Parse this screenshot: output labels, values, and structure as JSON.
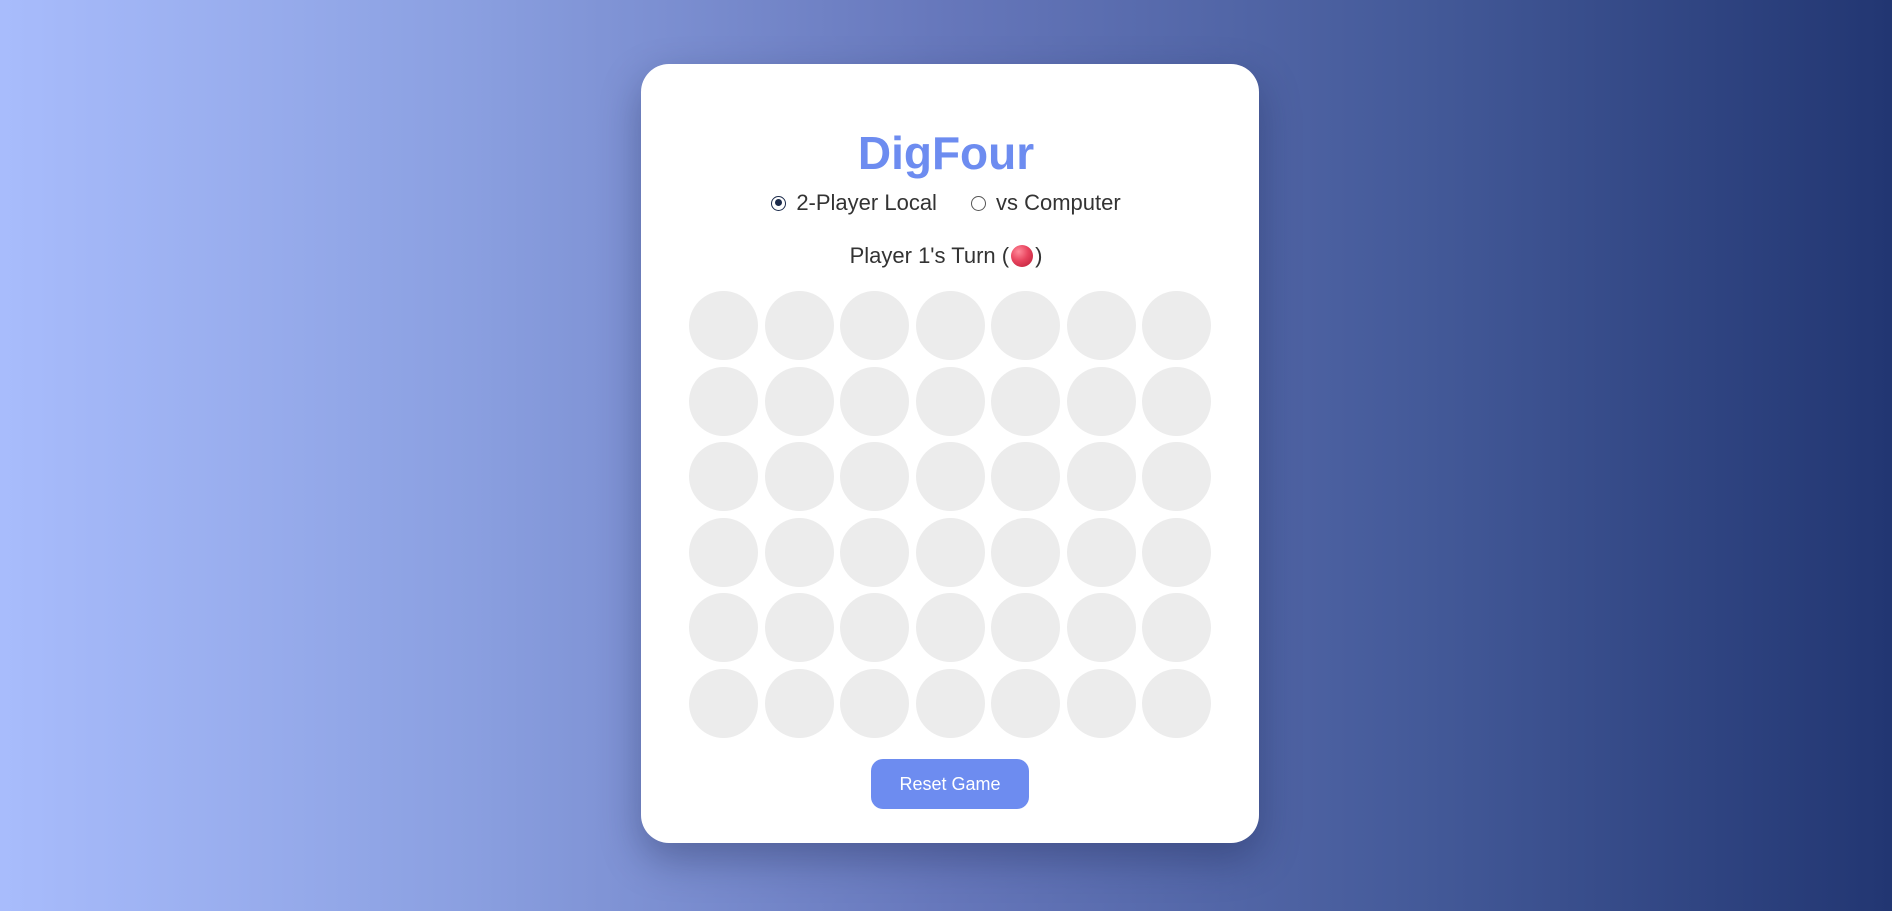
{
  "game": {
    "title": "DigFour",
    "modes": [
      {
        "label": "2-Player Local",
        "selected": true
      },
      {
        "label": "vs Computer",
        "selected": false
      }
    ],
    "status": {
      "prefix": "Player 1's Turn (",
      "suffix": ")",
      "current_player_color": "#e8445e"
    },
    "board": {
      "rows": 6,
      "columns": 7,
      "cells": [
        [
          "empty",
          "empty",
          "empty",
          "empty",
          "empty",
          "empty",
          "empty"
        ],
        [
          "empty",
          "empty",
          "empty",
          "empty",
          "empty",
          "empty",
          "empty"
        ],
        [
          "empty",
          "empty",
          "empty",
          "empty",
          "empty",
          "empty",
          "empty"
        ],
        [
          "empty",
          "empty",
          "empty",
          "empty",
          "empty",
          "empty",
          "empty"
        ],
        [
          "empty",
          "empty",
          "empty",
          "empty",
          "empty",
          "empty",
          "empty"
        ],
        [
          "empty",
          "empty",
          "empty",
          "empty",
          "empty",
          "empty",
          "empty"
        ]
      ]
    },
    "reset_label": "Reset Game"
  },
  "colors": {
    "accent": "#6d8cf0",
    "empty_cell": "#ececec",
    "player1": "#e8445e",
    "card": "#ffffff"
  }
}
